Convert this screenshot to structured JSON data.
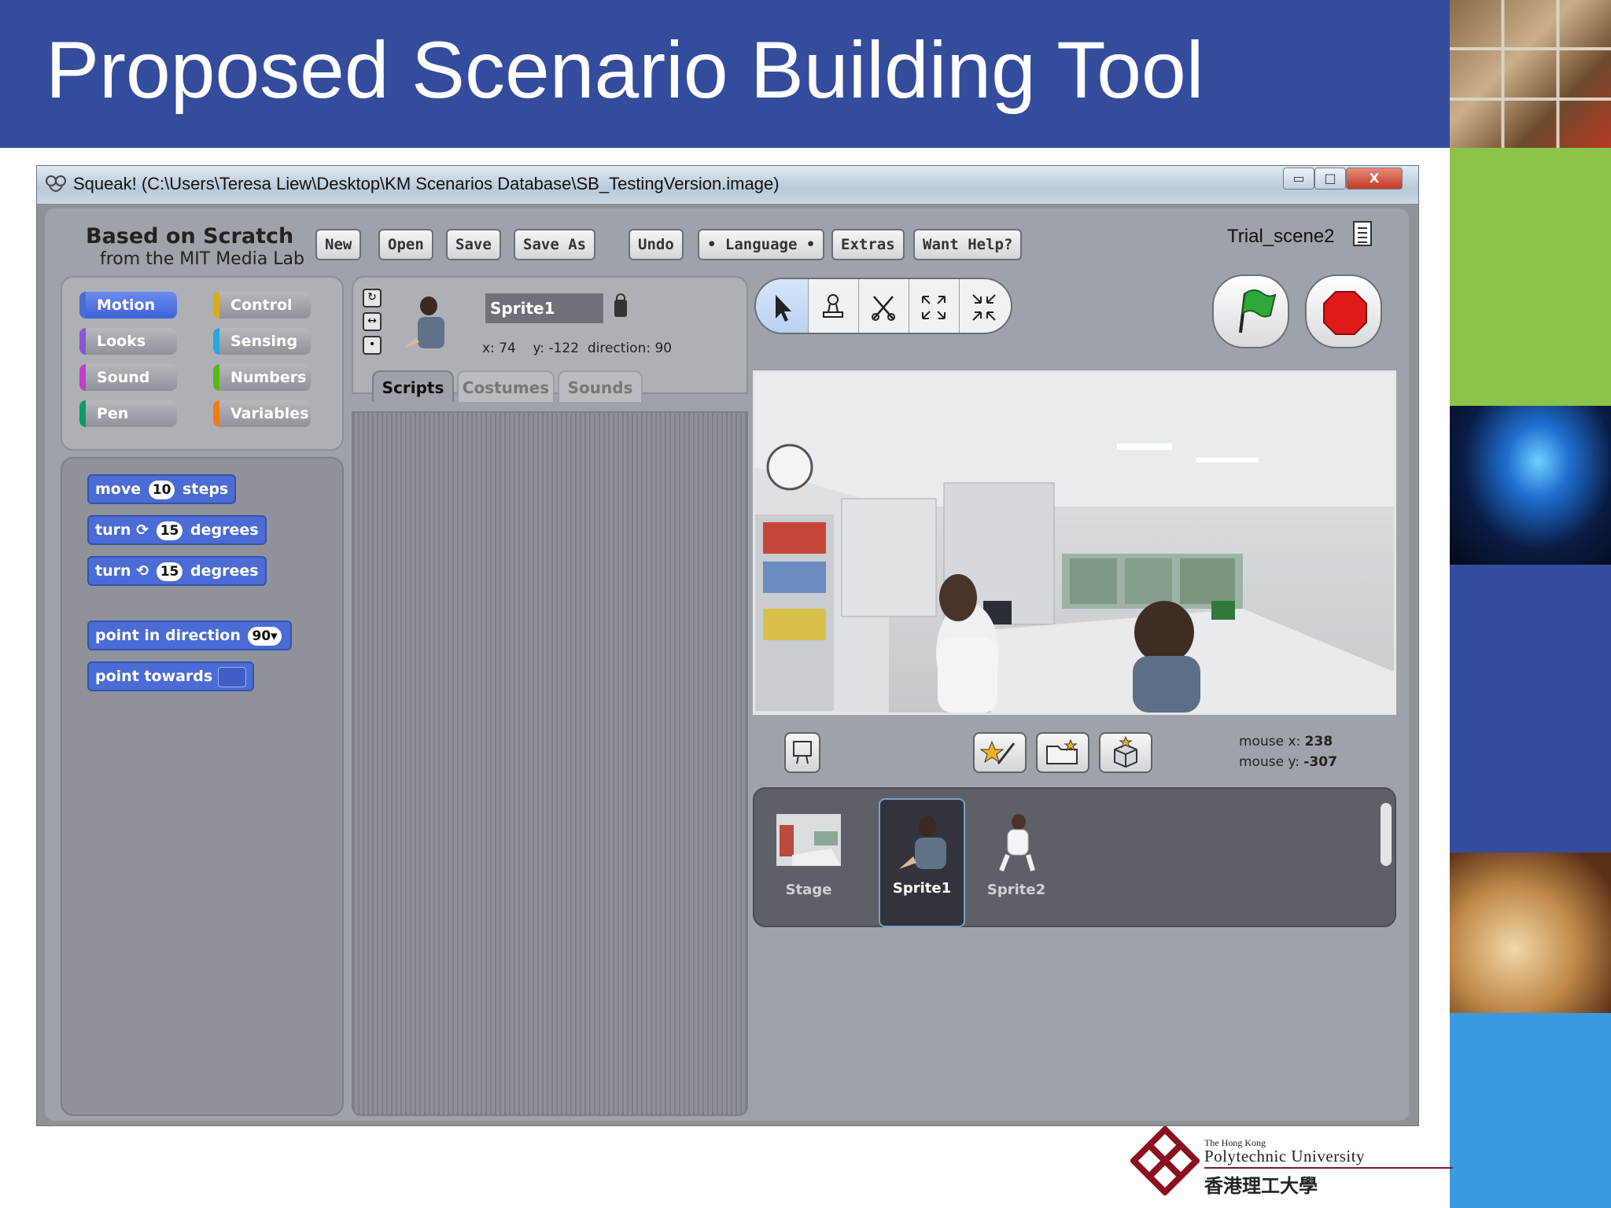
{
  "slide": {
    "title": "Proposed Scenario Building Tool",
    "logo": {
      "line1": "The Hong Kong",
      "line2": "Polytechnic University",
      "line3": "香港理工大學"
    }
  },
  "window": {
    "title": "Squeak! (C:\\Users\\Teresa Liew\\Desktop\\KM Scenarios Database\\SB_TestingVersion.image)",
    "controls": {
      "minimize": "▭",
      "maximize": "□",
      "close": "X"
    }
  },
  "app": {
    "brand_line1": "Based on Scratch",
    "brand_line2": "from the MIT Media Lab",
    "menu": [
      "New",
      "Open",
      "Save",
      "Save As",
      "Undo",
      "• Language •",
      "Extras",
      "Want Help?"
    ],
    "project_name": "Trial_scene2",
    "categories": [
      {
        "label": "Motion",
        "color": "#4a6cd4",
        "active": true
      },
      {
        "label": "Control",
        "color": "#e1a91a",
        "active": false
      },
      {
        "label": "Looks",
        "color": "#8a55d7",
        "active": false
      },
      {
        "label": "Sensing",
        "color": "#2ca5e2",
        "active": false
      },
      {
        "label": "Sound",
        "color": "#bb42c3",
        "active": false
      },
      {
        "label": "Numbers",
        "color": "#5cb712",
        "active": false
      },
      {
        "label": "Pen",
        "color": "#0e9a6c",
        "active": false
      },
      {
        "label": "Variables",
        "color": "#ee7d16",
        "active": false
      }
    ],
    "blocks": {
      "move": {
        "pre": "move",
        "num": "10",
        "post": "steps"
      },
      "turn_cw": {
        "pre": "turn",
        "num": "15",
        "post": "degrees"
      },
      "turn_ccw": {
        "pre": "turn",
        "num": "15",
        "post": "degrees"
      },
      "point_dir": {
        "pre": "point in direction",
        "num": "90▾"
      },
      "point_towards": {
        "pre": "point towards"
      }
    },
    "sprite": {
      "name": "Sprite1",
      "x_label": "x:",
      "x": "74",
      "y_label": "y:",
      "y": "-122",
      "dir_label": "direction:",
      "direction": "90"
    },
    "tabs": [
      "Scripts",
      "Costumes",
      "Sounds"
    ],
    "mouse": {
      "x_label": "mouse x:",
      "x": "238",
      "y_label": "mouse y:",
      "y": "-307"
    },
    "tray": [
      {
        "label": "Stage",
        "selected": false
      },
      {
        "label": "Sprite1",
        "selected": true
      },
      {
        "label": "Sprite2",
        "selected": false
      }
    ],
    "icons": {
      "tools": [
        "pointer-icon",
        "stamp-icon",
        "scissors-icon",
        "grow-icon",
        "shrink-icon"
      ],
      "go": "green-flag-icon",
      "stop": "stop-sign-icon",
      "sprite_buttons": [
        "paint-new-sprite-icon",
        "open-sprite-icon",
        "surprise-sprite-icon"
      ]
    }
  }
}
